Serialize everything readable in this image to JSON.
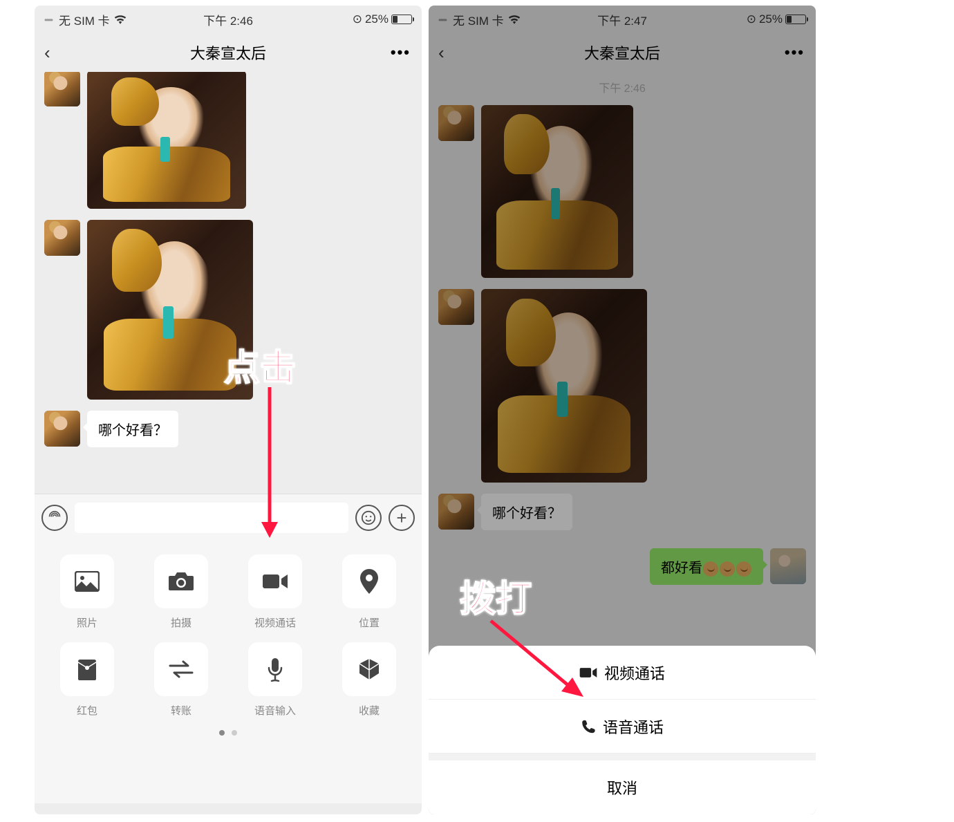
{
  "left": {
    "status": {
      "carrier": "无 SIM 卡",
      "time": "下午 2:46",
      "battery": "25%"
    },
    "nav": {
      "title": "大秦宣太后"
    },
    "messages": [
      {
        "type": "image"
      },
      {
        "type": "image"
      },
      {
        "type": "text",
        "text": "哪个好看？"
      }
    ],
    "panel": [
      {
        "icon": "photo",
        "label": "照片"
      },
      {
        "icon": "camera",
        "label": "拍摄"
      },
      {
        "icon": "video",
        "label": "视频通话"
      },
      {
        "icon": "location",
        "label": "位置"
      },
      {
        "icon": "redpacket",
        "label": "红包"
      },
      {
        "icon": "transfer",
        "label": "转账"
      },
      {
        "icon": "voice",
        "label": "语音输入"
      },
      {
        "icon": "favorite",
        "label": "收藏"
      }
    ],
    "annotation": "点击"
  },
  "right": {
    "status": {
      "carrier": "无 SIM 卡",
      "time": "下午 2:47",
      "battery": "25%"
    },
    "nav": {
      "title": "大秦宣太后"
    },
    "timestamp": "下午 2:46",
    "messages": [
      {
        "type": "image",
        "side": "left"
      },
      {
        "type": "image",
        "side": "left"
      },
      {
        "type": "text",
        "side": "left",
        "text": "哪个好看？"
      },
      {
        "type": "text",
        "side": "right",
        "text": "都好看"
      }
    ],
    "sheet": {
      "video": "视频通话",
      "voice": "语音通话",
      "cancel": "取消"
    },
    "annotation": "拨打"
  }
}
